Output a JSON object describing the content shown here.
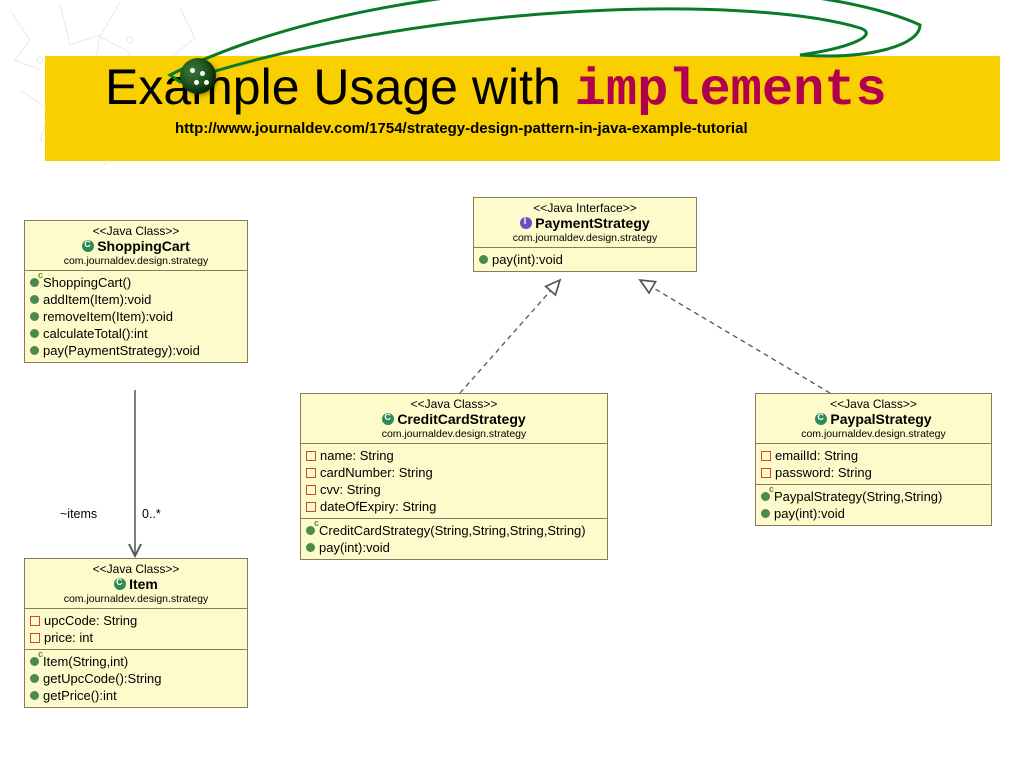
{
  "header": {
    "title_pre": "Example Usage with ",
    "title_keyword": "implements",
    "url": "http://www.journaldev.com/1754/strategy-design-pattern-in-java-example-tutorial"
  },
  "classes": {
    "cart": {
      "stereo": "<<Java Class>>",
      "name": "ShoppingCart",
      "pkg": "com.journaldev.design.strategy",
      "members": {
        "m0": "ShoppingCart()",
        "m1": "addItem(Item):void",
        "m2": "removeItem(Item):void",
        "m3": "calculateTotal():int",
        "m4": "pay(PaymentStrategy):void"
      }
    },
    "item": {
      "stereo": "<<Java Class>>",
      "name": "Item",
      "pkg": "com.journaldev.design.strategy",
      "attrs": {
        "a0": "upcCode: String",
        "a1": "price: int"
      },
      "members": {
        "m0": "Item(String,int)",
        "m1": "getUpcCode():String",
        "m2": "getPrice():int"
      }
    },
    "strategy": {
      "stereo": "<<Java Interface>>",
      "name": "PaymentStrategy",
      "pkg": "com.journaldev.design.strategy",
      "members": {
        "m0": "pay(int):void"
      }
    },
    "credit": {
      "stereo": "<<Java Class>>",
      "name": "CreditCardStrategy",
      "pkg": "com.journaldev.design.strategy",
      "attrs": {
        "a0": "name: String",
        "a1": "cardNumber: String",
        "a2": "cvv: String",
        "a3": "dateOfExpiry: String"
      },
      "members": {
        "m0": "CreditCardStrategy(String,String,String,String)",
        "m1": "pay(int):void"
      }
    },
    "paypal": {
      "stereo": "<<Java Class>>",
      "name": "PaypalStrategy",
      "pkg": "com.journaldev.design.strategy",
      "attrs": {
        "a0": "emailId: String",
        "a1": "password: String"
      },
      "members": {
        "m0": "PaypalStrategy(String,String)",
        "m1": "pay(int):void"
      }
    }
  },
  "associations": {
    "cart_items_name": "~items",
    "cart_items_mult": "0..*"
  }
}
